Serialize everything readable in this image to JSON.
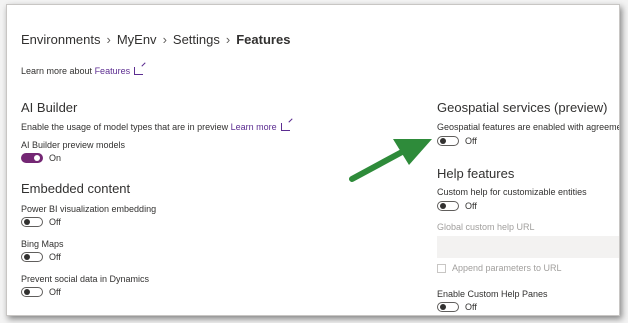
{
  "breadcrumb": {
    "items": [
      "Environments",
      "MyEnv",
      "Settings"
    ],
    "current": "Features",
    "separator": "›"
  },
  "learn_more": {
    "prefix": "Learn more about",
    "link": "Features"
  },
  "ai_builder": {
    "heading": "AI Builder",
    "description": "Enable the usage of model types that are in preview",
    "learn_more_link": "Learn more",
    "preview_models": {
      "label": "AI Builder preview models",
      "state": "On",
      "on": true
    }
  },
  "embedded": {
    "heading": "Embedded content",
    "power_bi": {
      "label": "Power BI visualization embedding",
      "state": "Off"
    },
    "bing_maps": {
      "label": "Bing Maps",
      "state": "Off"
    },
    "social": {
      "label": "Prevent social data in Dynamics",
      "state": "Off"
    }
  },
  "geospatial": {
    "heading": "Geospatial services (preview)",
    "description": "Geospatial features are enabled with agreement",
    "state": "Off"
  },
  "help": {
    "heading": "Help features",
    "custom_help": {
      "label": "Custom help for customizable entities",
      "state": "Off"
    },
    "global_url": {
      "label": "Global custom help URL",
      "value": ""
    },
    "append_params": {
      "label": "Append parameters to URL"
    },
    "custom_panes": {
      "label": "Enable Custom Help Panes",
      "state": "Off"
    }
  },
  "colors": {
    "accent": "#742774",
    "link": "#5c2d91",
    "arrow": "#2e8b3a"
  }
}
